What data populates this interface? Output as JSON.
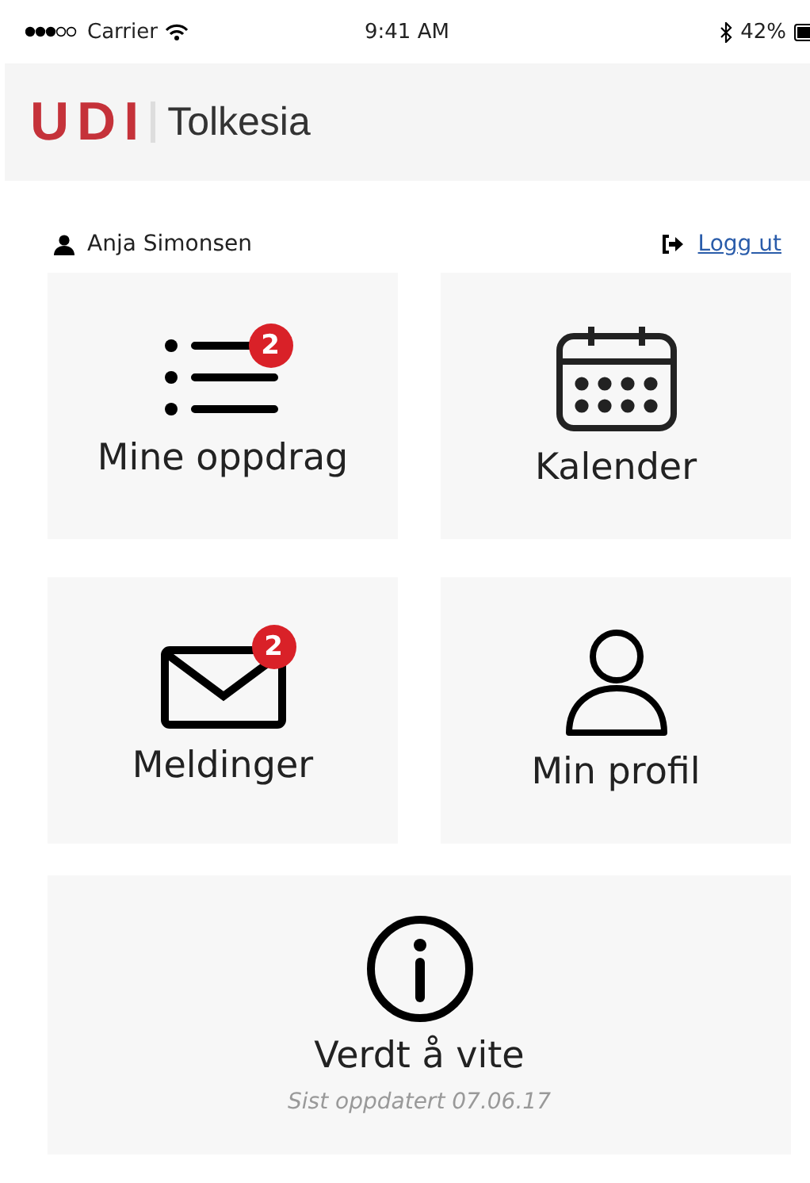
{
  "status_bar": {
    "carrier": "Carrier",
    "time": "9:41 AM",
    "battery": "42%"
  },
  "header": {
    "logo": "UDI",
    "app_name": "Tolkesia"
  },
  "user": {
    "name": "Anja Simonsen",
    "logout": "Logg ut"
  },
  "tiles": [
    {
      "kind": "list",
      "label": "Mine oppdrag",
      "badge": "2"
    },
    {
      "kind": "calendar",
      "label": "Kalender"
    },
    {
      "kind": "mail",
      "label": "Meldinger",
      "badge": "2"
    },
    {
      "kind": "person",
      "label": "Min profil"
    },
    {
      "kind": "info",
      "label": "Verdt å vite",
      "note": "Sist oppdatert 07.06.17",
      "wide": true
    }
  ]
}
